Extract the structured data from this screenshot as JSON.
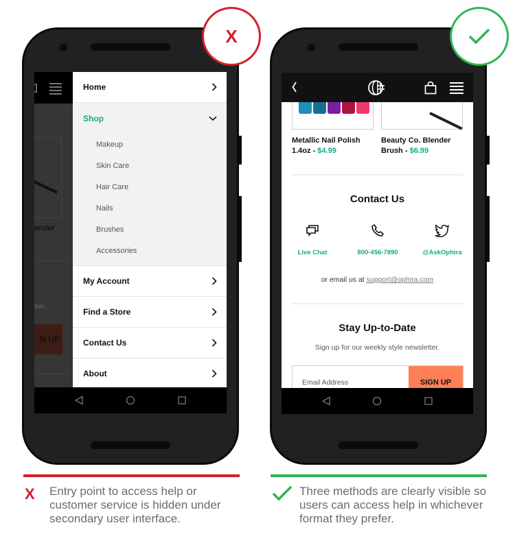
{
  "bad_example": {
    "badge_symbol": "X",
    "caption_icon": "X",
    "caption": "Entry point to access help or customer service is hidden under secondary user interface.",
    "accent_color": "#d3202a",
    "background_page": {
      "product_fragment": "ender",
      "newsletter_fragment": "tter.",
      "signup_fragment": "N UP"
    },
    "menu": {
      "items": [
        {
          "label": "Home",
          "icon": "chevron-right-icon"
        },
        {
          "label": "Shop",
          "icon": "chevron-down-icon",
          "expanded": true,
          "subitems": [
            "Makeup",
            "Skin Care",
            "Hair Care",
            "Nails",
            "Brushes",
            "Accessories"
          ]
        },
        {
          "label": "My Account",
          "icon": "chevron-right-icon"
        },
        {
          "label": "Find a Store",
          "icon": "chevron-right-icon"
        },
        {
          "label": "Contact Us",
          "icon": "chevron-right-icon"
        },
        {
          "label": "About",
          "icon": "chevron-right-icon"
        }
      ]
    }
  },
  "good_example": {
    "badge_symbol": "check-icon",
    "caption": "Three methods are clearly visible so users can access help in whichever format they prefer.",
    "accent_color": "#2eb653",
    "topbar": {
      "back_icon": "back-chevron-icon",
      "logo_icon": "ophira-logo-icon",
      "bag_icon": "shopping-bag-icon",
      "menu_icon": "hamburger-menu-icon"
    },
    "products": [
      {
        "name": "Metallic Nail Polish 1.4oz - ",
        "price": "$4.99"
      },
      {
        "name": "Beauty Co. Blender Brush - ",
        "price": "$6.99"
      }
    ],
    "contact": {
      "title": "Contact Us",
      "methods": [
        {
          "label": "Live Chat",
          "icon": "chat-icon"
        },
        {
          "label": "800-456-7890",
          "icon": "phone-icon"
        },
        {
          "label": "@AskOphira",
          "icon": "twitter-icon"
        }
      ],
      "email_prefix": "or email us at ",
      "email": "support@ophira.com"
    },
    "newsletter": {
      "title": "Stay Up-to-Date",
      "subtitle": "Sign up for our weekly style newsletter.",
      "email_placeholder": "Email Address",
      "button_label": "SIGN UP"
    }
  },
  "colors": {
    "brand_green": "#1aa888",
    "signup_orange": "#fe7f55"
  },
  "system_nav": [
    "back-triangle-icon",
    "home-circle-icon",
    "recents-square-icon"
  ]
}
